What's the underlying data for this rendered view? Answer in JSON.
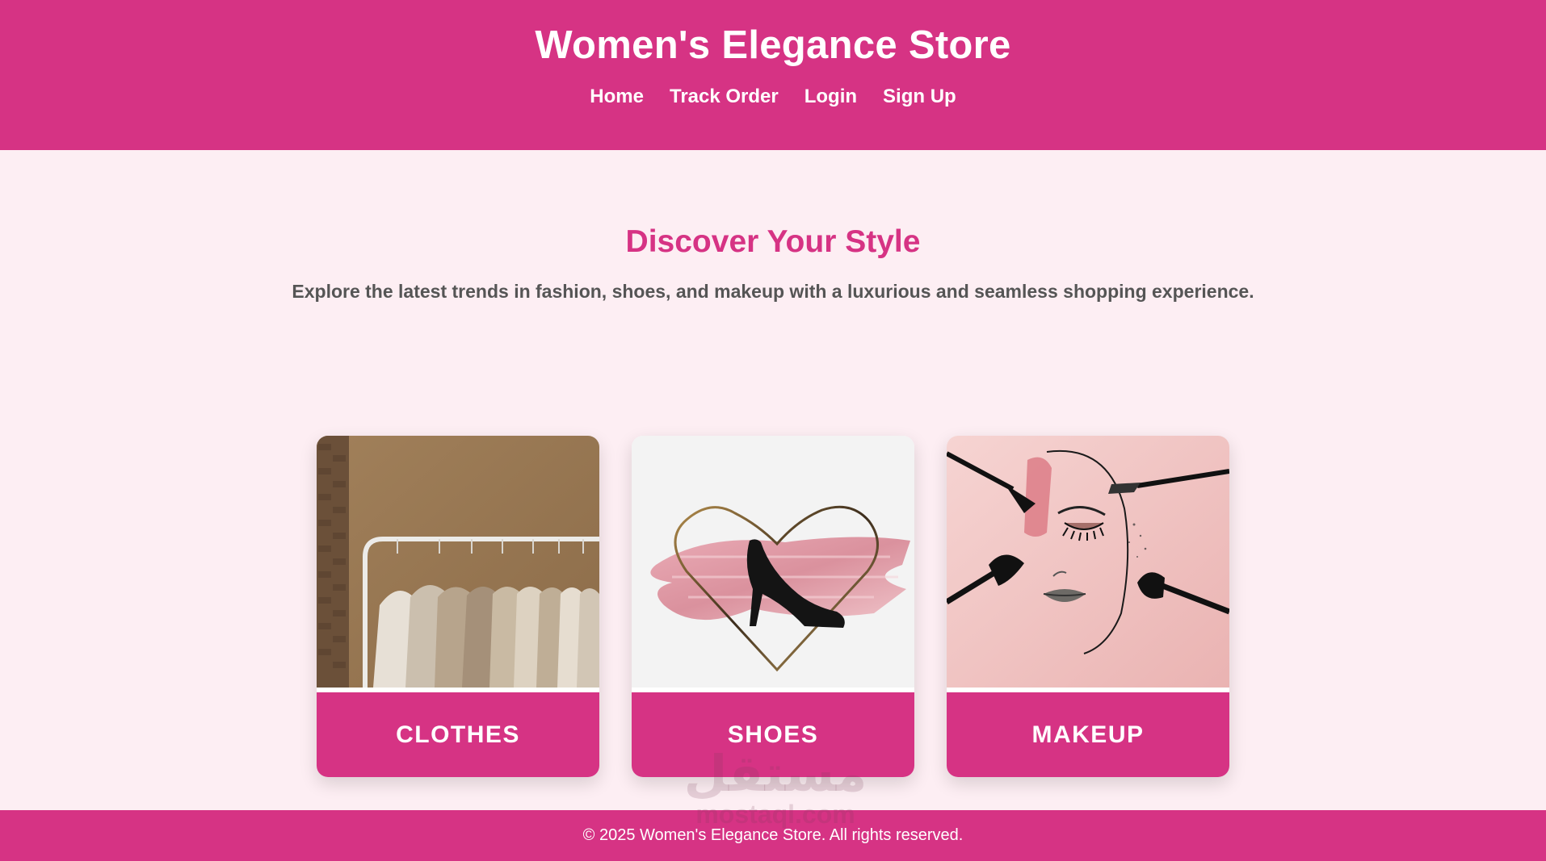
{
  "header": {
    "title": "Women's Elegance Store",
    "nav": [
      {
        "label": "Home"
      },
      {
        "label": "Track Order"
      },
      {
        "label": "Login"
      },
      {
        "label": "Sign Up"
      }
    ]
  },
  "hero": {
    "title": "Discover Your Style",
    "subtitle": "Explore the latest trends in fashion, shoes, and makeup with a luxurious and seamless shopping experience."
  },
  "categories": [
    {
      "label": "CLOTHES",
      "image": "clothes-rack-image"
    },
    {
      "label": "SHOES",
      "image": "high-heel-heart-image"
    },
    {
      "label": "MAKEUP",
      "image": "makeup-face-brushes-image"
    }
  ],
  "footer": {
    "text": "© 2025 Women's Elegance Store. All rights reserved."
  },
  "watermark": {
    "arabic": "مستقل",
    "latin": "mostaql.com"
  },
  "colors": {
    "brand": "#d63384",
    "background": "#fdeef3",
    "subtitle_text": "#555555"
  }
}
